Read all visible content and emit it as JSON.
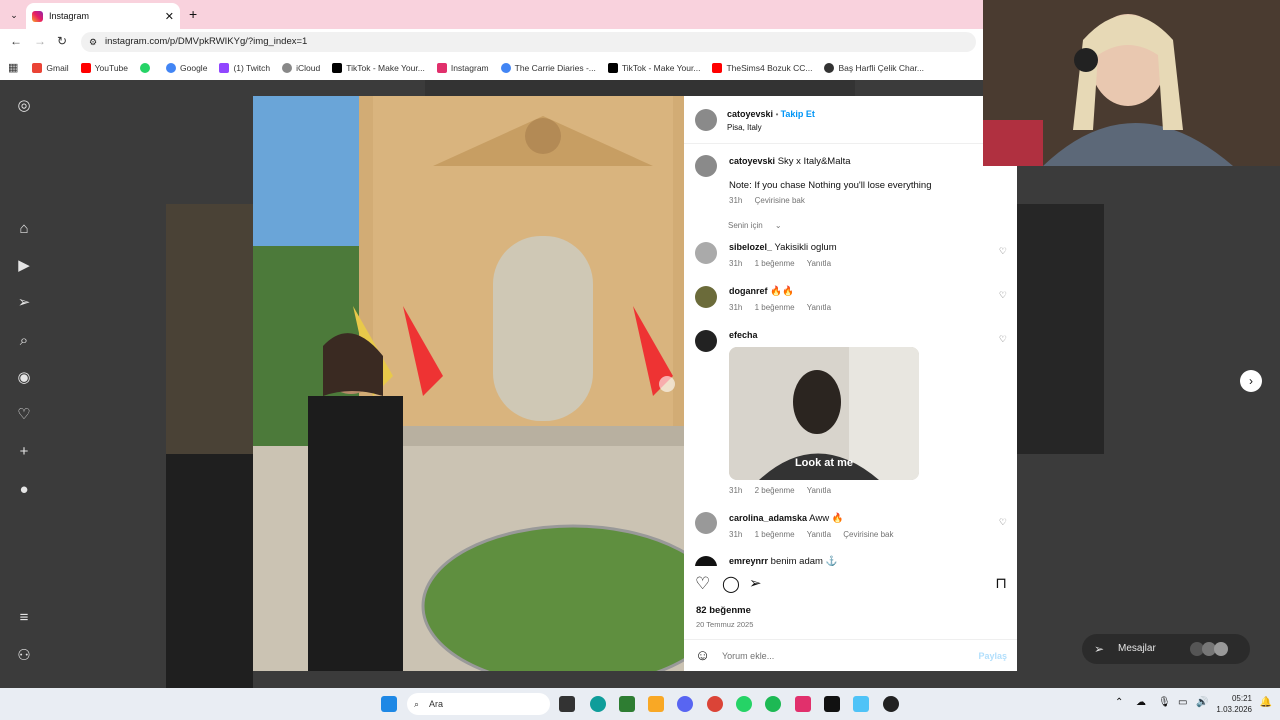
{
  "browser": {
    "tab_title": "Instagram",
    "url": "instagram.com/p/DMVpkRWIKYg/?img_index=1",
    "bookmarks": [
      {
        "label": "Gmail",
        "color": "#ea4335"
      },
      {
        "label": "YouTube",
        "color": "#ff0000"
      },
      {
        "label": "",
        "color": "#25d366"
      },
      {
        "label": "Google",
        "color": "#4285f4"
      },
      {
        "label": "(1) Twitch",
        "color": "#9146ff"
      },
      {
        "label": "iCloud",
        "color": "#888888"
      },
      {
        "label": "TikTok - Make Your...",
        "color": "#000000"
      },
      {
        "label": "Instagram",
        "color": "#e1306c"
      },
      {
        "label": "The Carrie Diaries -...",
        "color": "#4285f4"
      },
      {
        "label": "TikTok - Make Your...",
        "color": "#000000"
      },
      {
        "label": "TheSims4 Bozuk CC...",
        "color": "#ff0000"
      },
      {
        "label": "Baş Harfli Çelik Char...",
        "color": "#333333"
      }
    ]
  },
  "post": {
    "author": "catoyevski",
    "follow_label": "Takip Et",
    "location": "Pisa, Italy",
    "caption_user": "catoyevski",
    "caption_text": "Sky x Italy&Malta",
    "caption_note": "Note: If you chase Nothing you'll lose everything",
    "caption_time": "31h",
    "caption_translate": "Çevirisine bak",
    "sort_label": "Senin için",
    "likes": "82 beğenme",
    "date": "20 Temmuz 2025",
    "comment_placeholder": "Yorum ekle...",
    "share_label": "Paylaş",
    "gif_caption": "Look at me"
  },
  "comments": [
    {
      "user": "sibelozel_",
      "text": "Yakisikli oglum",
      "time": "31h",
      "likes": "1 beğenme",
      "reply": "Yanıtla",
      "translate": ""
    },
    {
      "user": "doganref",
      "text": "🔥🔥",
      "time": "31h",
      "likes": "1 beğenme",
      "reply": "Yanıtla",
      "translate": ""
    },
    {
      "user": "efecha",
      "text": "",
      "time": "31h",
      "likes": "2 beğenme",
      "reply": "Yanıtla",
      "translate": ""
    },
    {
      "user": "carolina_adamska",
      "text": "Aww 🔥",
      "time": "31h",
      "likes": "1 beğenme",
      "reply": "Yanıtla",
      "translate": "Çevirisine bak"
    },
    {
      "user": "emreynrr",
      "text": "benim adam ⚓",
      "time": "",
      "likes": "",
      "reply": "",
      "translate": ""
    }
  ],
  "messages_label": "Mesajlar",
  "taskbar": {
    "search_placeholder": "Ara",
    "time": "05:21",
    "date": "1.03.2026"
  }
}
